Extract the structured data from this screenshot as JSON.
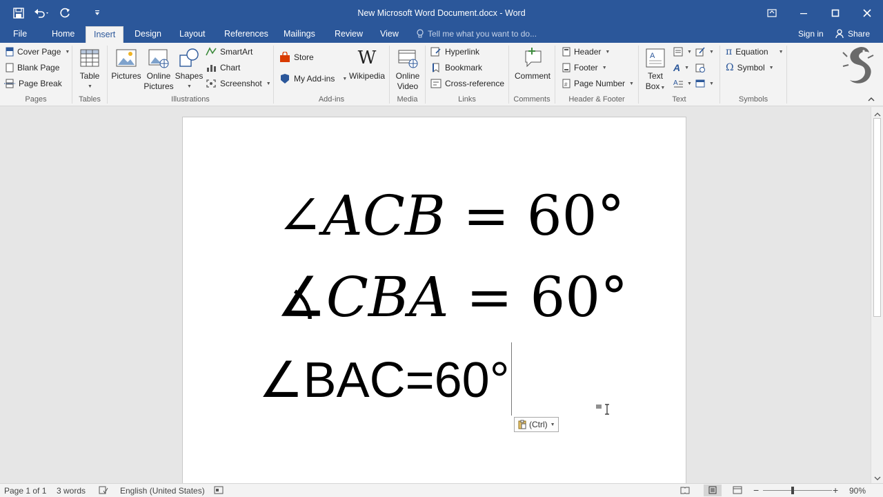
{
  "window": {
    "title": "New Microsoft Word Document.docx - Word",
    "accent": "#2b579a"
  },
  "quick_access": {
    "icons": [
      "save-icon",
      "undo-icon",
      "redo-icon",
      "customize-icon"
    ]
  },
  "tabs": [
    {
      "label": "File"
    },
    {
      "label": "Home"
    },
    {
      "label": "Insert",
      "active": true
    },
    {
      "label": "Design"
    },
    {
      "label": "Layout"
    },
    {
      "label": "References"
    },
    {
      "label": "Mailings"
    },
    {
      "label": "Review"
    },
    {
      "label": "View"
    }
  ],
  "tell_me": "Tell me what you want to do...",
  "account": {
    "sign_in": "Sign in",
    "share": "Share"
  },
  "ribbon": {
    "pages": {
      "label": "Pages",
      "cover_page": "Cover Page",
      "blank_page": "Blank Page",
      "page_break": "Page Break"
    },
    "tables": {
      "label": "Tables",
      "table": "Table"
    },
    "illustrations": {
      "label": "Illustrations",
      "pictures": "Pictures",
      "online": "Online",
      "pictures2": "Pictures",
      "shapes": "Shapes",
      "smartart": "SmartArt",
      "chart": "Chart",
      "screenshot": "Screenshot"
    },
    "addins": {
      "label": "Add-ins",
      "store": "Store",
      "my_addins": "My Add-ins",
      "wikipedia": "Wikipedia"
    },
    "media": {
      "label": "Media",
      "online": "Online",
      "video": "Video"
    },
    "links": {
      "label": "Links",
      "hyperlink": "Hyperlink",
      "bookmark": "Bookmark",
      "cross_reference": "Cross-reference"
    },
    "comments": {
      "label": "Comments",
      "comment": "Comment"
    },
    "header_footer": {
      "label": "Header & Footer",
      "header": "Header",
      "footer": "Footer",
      "page_number": "Page Number"
    },
    "text": {
      "label": "Text",
      "text": "Text",
      "box": "Box"
    },
    "symbols": {
      "label": "Symbols",
      "equation": "Equation",
      "symbol": "Symbol"
    }
  },
  "document": {
    "line1": {
      "angle": "∠",
      "letters": "ACB",
      "rest": " = 60°"
    },
    "line2": {
      "angle": "∡",
      "letters": "CBA",
      "rest": " = 60°"
    },
    "line3": "∠BAC=60°",
    "paste_label": "(Ctrl)"
  },
  "status": {
    "page": "Page 1 of 1",
    "words": "3 words",
    "language": "English (United States)",
    "zoom": "90%"
  }
}
